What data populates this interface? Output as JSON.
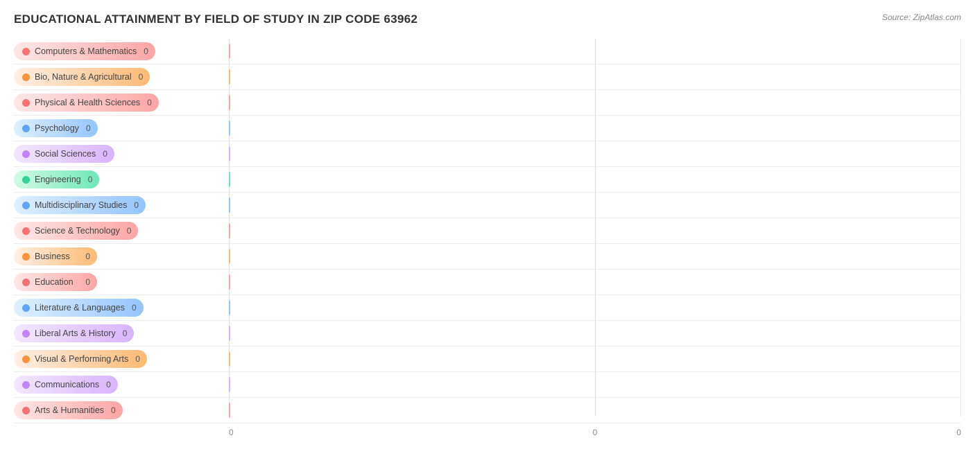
{
  "chart": {
    "title": "EDUCATIONAL ATTAINMENT BY FIELD OF STUDY IN ZIP CODE 63962",
    "source": "Source: ZipAtlas.com",
    "bars": [
      {
        "id": "computers",
        "label": "Computers & Mathematics",
        "value": 0,
        "colorClass": "computers"
      },
      {
        "id": "bio",
        "label": "Bio, Nature & Agricultural",
        "value": 0,
        "colorClass": "bio"
      },
      {
        "id": "physical",
        "label": "Physical & Health Sciences",
        "value": 0,
        "colorClass": "physical"
      },
      {
        "id": "psychology",
        "label": "Psychology",
        "value": 0,
        "colorClass": "psychology"
      },
      {
        "id": "social",
        "label": "Social Sciences",
        "value": 0,
        "colorClass": "social"
      },
      {
        "id": "engineering",
        "label": "Engineering",
        "value": 0,
        "colorClass": "engineering"
      },
      {
        "id": "multidisciplinary",
        "label": "Multidisciplinary Studies",
        "value": 0,
        "colorClass": "multidisciplinary"
      },
      {
        "id": "science",
        "label": "Science & Technology",
        "value": 0,
        "colorClass": "science"
      },
      {
        "id": "business",
        "label": "Business",
        "value": 0,
        "colorClass": "business"
      },
      {
        "id": "education",
        "label": "Education",
        "value": 0,
        "colorClass": "education"
      },
      {
        "id": "literature",
        "label": "Literature & Languages",
        "value": 0,
        "colorClass": "literature"
      },
      {
        "id": "liberal",
        "label": "Liberal Arts & History",
        "value": 0,
        "colorClass": "liberal"
      },
      {
        "id": "visual",
        "label": "Visual & Performing Arts",
        "value": 0,
        "colorClass": "visual"
      },
      {
        "id": "communications",
        "label": "Communications",
        "value": 0,
        "colorClass": "communications"
      },
      {
        "id": "arts",
        "label": "Arts & Humanities",
        "value": 0,
        "colorClass": "arts"
      }
    ],
    "xAxisLabels": [
      "0",
      "0",
      "0"
    ]
  }
}
